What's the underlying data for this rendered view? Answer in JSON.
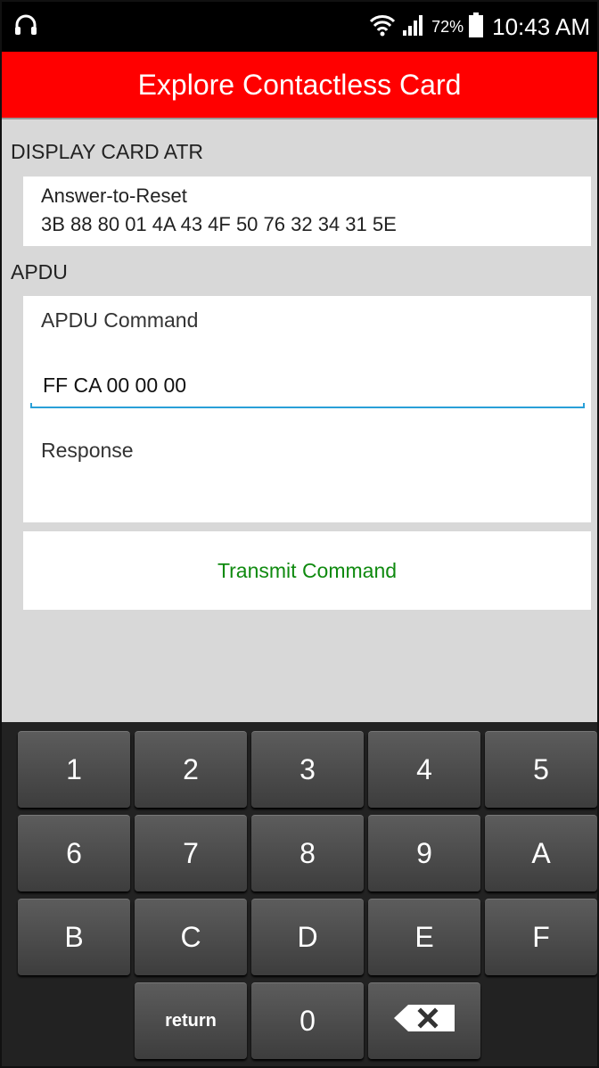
{
  "status_bar": {
    "icons": [
      "headphones-icon",
      "wifi-icon",
      "signal-icon",
      "battery-icon"
    ],
    "battery_pct": "72%",
    "time": "10:43 AM"
  },
  "app_bar": {
    "title": "Explore Contactless Card",
    "color": "#ff0000"
  },
  "atr_section": {
    "label": "DISPLAY CARD ATR",
    "title": "Answer-to-Reset",
    "value": "3B 88 80 01 4A 43 4F 50 76 32 34 31 5E"
  },
  "apdu_section": {
    "label": "APDU",
    "command_label": "APDU Command",
    "command_value": "FF CA 00 00 00",
    "response_label": "Response"
  },
  "transmit_button": {
    "label": "Transmit Command",
    "color": "#0f8a0f"
  },
  "keyboard": {
    "rows": [
      [
        "1",
        "2",
        "3",
        "4",
        "5"
      ],
      [
        "6",
        "7",
        "8",
        "9",
        "A"
      ],
      [
        "B",
        "C",
        "D",
        "E",
        "F"
      ]
    ],
    "return_label": "return",
    "zero_label": "0",
    "backspace_icon": "backspace-icon"
  }
}
